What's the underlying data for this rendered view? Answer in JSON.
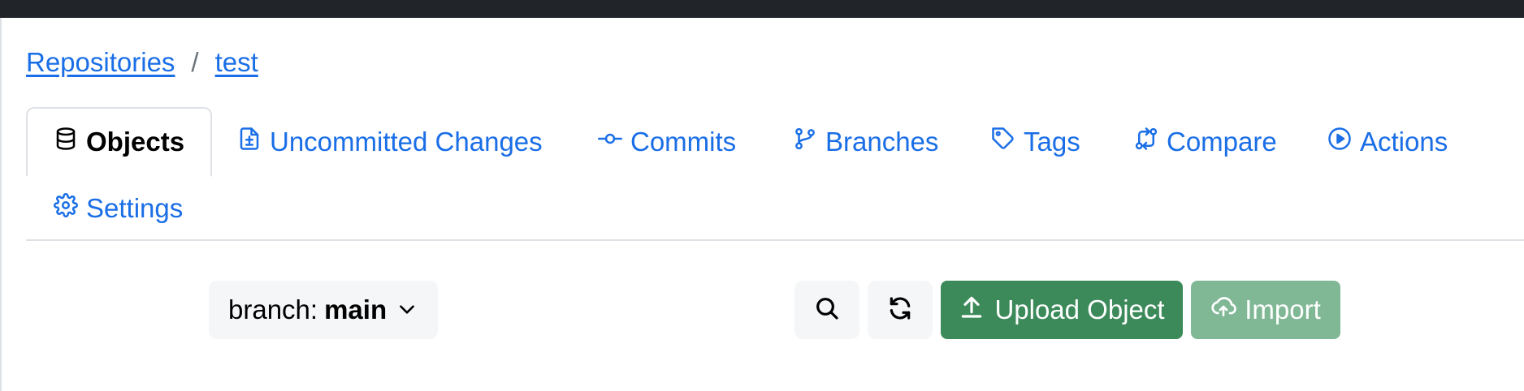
{
  "breadcrumb": {
    "root": "Repositories",
    "separator": "/",
    "current": "test"
  },
  "tabs": [
    {
      "label": "Objects",
      "icon": "database-icon",
      "active": true
    },
    {
      "label": "Uncommitted Changes",
      "icon": "file-diff-icon"
    },
    {
      "label": "Commits",
      "icon": "git-commit-icon"
    },
    {
      "label": "Branches",
      "icon": "git-branch-icon"
    },
    {
      "label": "Tags",
      "icon": "tag-icon"
    },
    {
      "label": "Compare",
      "icon": "git-compare-icon"
    },
    {
      "label": "Actions",
      "icon": "play-circle-icon"
    },
    {
      "label": "Settings",
      "icon": "gear-icon"
    }
  ],
  "toolbar": {
    "branch_prefix": "branch:",
    "branch_name": "main",
    "upload_label": "Upload Object",
    "import_label": "Import"
  },
  "colors": {
    "link": "#1a6ee6",
    "upload_button": "#3c8a5a",
    "import_button_disabled": "#80b896",
    "topbar": "#212529"
  }
}
